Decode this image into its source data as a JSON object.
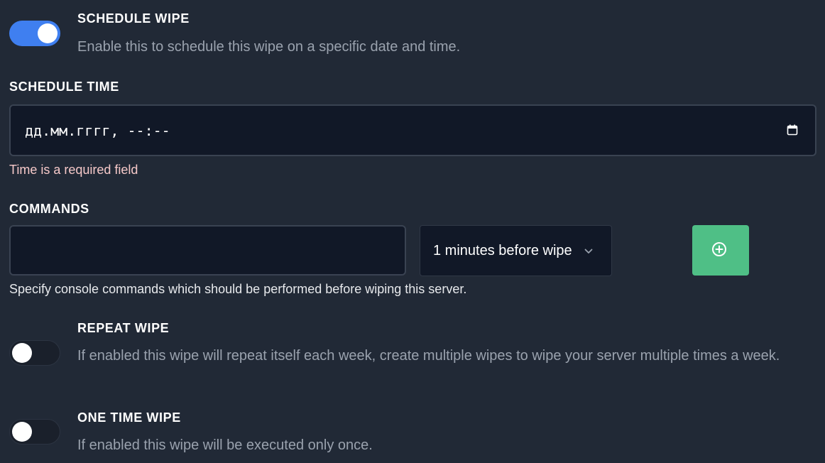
{
  "schedule_wipe": {
    "title": "SCHEDULE WIPE",
    "description": "Enable this to schedule this wipe on a specific date and time.",
    "enabled": true
  },
  "schedule_time": {
    "label": "SCHEDULE TIME",
    "value": "дд.мм.гггг, --:--",
    "error": "Time is a required field"
  },
  "commands": {
    "label": "COMMANDS",
    "input_value": "",
    "timing_select_value": "1 minutes before wipe",
    "helper": "Specify console commands which should be performed before wiping this server."
  },
  "repeat_wipe": {
    "title": "REPEAT WIPE",
    "description": "If enabled this wipe will repeat itself each week, create multiple wipes to wipe your server multiple times a week.",
    "enabled": false
  },
  "one_time_wipe": {
    "title": "ONE TIME WIPE",
    "description": "If enabled this wipe will be executed only once.",
    "enabled": false
  },
  "colors": {
    "background": "#212936",
    "accent": "#3f7ff0",
    "success": "#4fbf86",
    "error_text": "#f6c9c9",
    "field_bg": "#111827"
  },
  "icons": {
    "calendar": "calendar-icon",
    "chevron": "chevron-down-icon",
    "add": "plus-circle-icon"
  }
}
